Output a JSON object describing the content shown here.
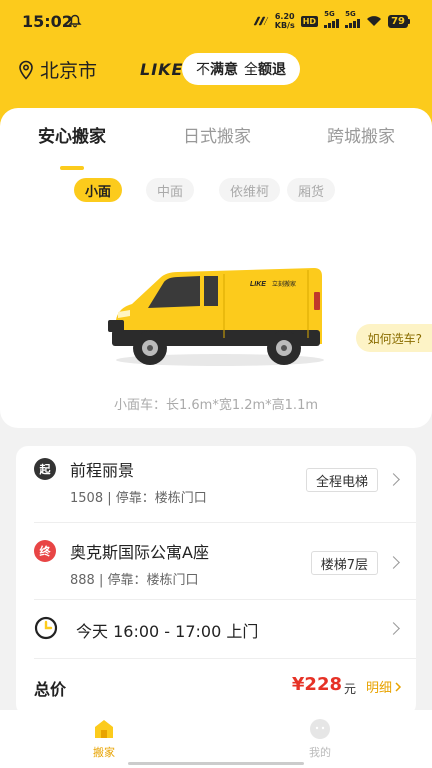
{
  "status_bar": {
    "time": "15:02",
    "net_speed_value": "6.20",
    "net_speed_unit": "KB/s",
    "hd": "HD",
    "signal1": "5G",
    "signal2": "5G",
    "battery": "79"
  },
  "header": {
    "city": "北京市",
    "brand": "LIKE",
    "promo_prefix": "不",
    "promo_bold1": "满意",
    "promo_mid": "全",
    "promo_bold2": "额退"
  },
  "tabs": [
    {
      "label": "安心搬家",
      "active": true
    },
    {
      "label": "日式搬家",
      "active": false
    },
    {
      "label": "跨城搬家",
      "active": false
    }
  ],
  "vehicle_chips": [
    {
      "label": "小面",
      "active": true
    },
    {
      "label": "中面",
      "active": false
    },
    {
      "label": "依维柯",
      "active": false
    },
    {
      "label": "厢货",
      "active": false
    }
  ],
  "van": {
    "logo_text": "LIKE",
    "side_text": "立刻搬家"
  },
  "help_button": "如何选车?",
  "van_dimensions": "小面车：长1.6m*宽1.2m*高1.1m",
  "addresses": {
    "start": {
      "badge": "起",
      "name": "前程丽景",
      "detail": "1508 | 停靠：楼栋门口",
      "tag": "全程电梯"
    },
    "end": {
      "badge": "终",
      "name": "奥克斯国际公寓A座",
      "detail": "888 | 停靠：楼栋门口",
      "tag": "楼梯7层"
    }
  },
  "time_slot": "今天  16:00 - 17:00  上门",
  "total": {
    "label": "总价",
    "price": "¥228",
    "unit": "元",
    "detail_link": "明细"
  },
  "bottom_nav": [
    {
      "label": "搬家",
      "active": true
    },
    {
      "label": "我的",
      "active": false
    }
  ],
  "colors": {
    "brand_yellow": "#fccb1c",
    "price_red": "#e63226",
    "start_badge": "#333333",
    "end_badge": "#e84545",
    "link_orange": "#e8a300"
  }
}
